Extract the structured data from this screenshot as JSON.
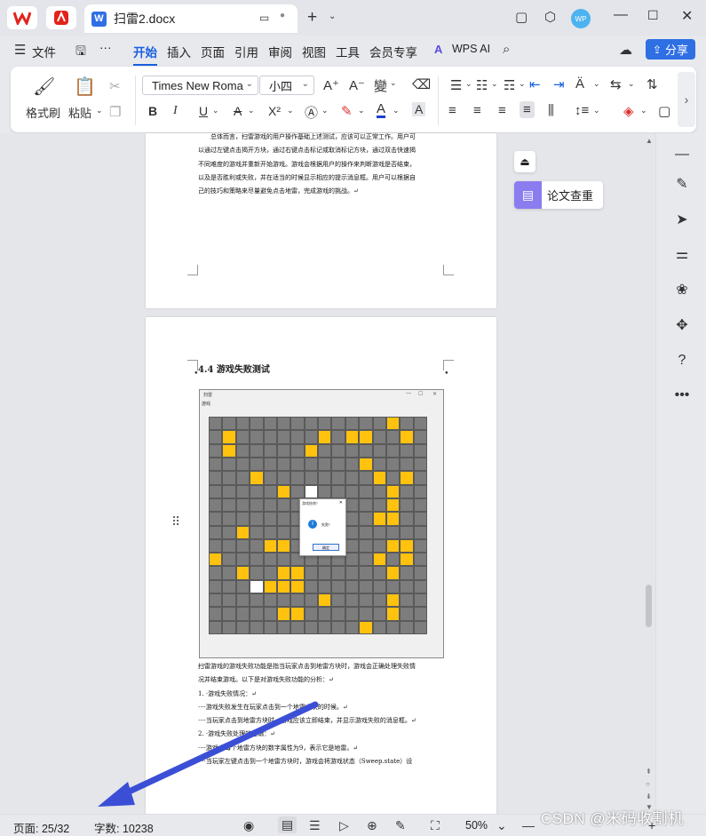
{
  "titlebar": {
    "tab_title": "扫雷2.docx",
    "avatar_text": "WP"
  },
  "menubar": {
    "file": "文件",
    "more": "···",
    "tabs": [
      "开始",
      "插入",
      "页面",
      "引用",
      "审阅",
      "视图",
      "工具",
      "会员专享"
    ],
    "active_tab": "开始",
    "wps_ai": "WPS AI",
    "share": "分享"
  },
  "ribbon": {
    "format_painter": "格式刷",
    "paste": "粘贴",
    "font_name": "Times New Roma",
    "font_size": "小四"
  },
  "document": {
    "page1_text": [
      "总体而言，扫雷游戏的用户操作基础上述测试，应该可以正常工作。用户可",
      "以通过左键点击揭开方块，通过右键点击标记或取消标记方块，通过双击快速揭",
      "不同难度的游戏并重新开始游戏。游戏会根据用户的操作来判断游戏是否结束，",
      "以及是否胜利或失败，并在适当的时候显示相应的提示消息框。用户可以根据自",
      "己的技巧和策略来尽量避免点击地雷，完成游戏的挑战。↵"
    ],
    "section_heading": "4.4 游戏失败测试",
    "game_window_title": "扫雷",
    "game_menu": "游戏",
    "dialog_title": "游戏结束！",
    "dialog_message": "失败！",
    "dialog_button": "确定",
    "page2_text": [
      "扫雷游戏的游戏失败功能是指当玩家点击到地雷方块时，游戏会正确处理失败情",
      "况并结束游戏。以下是对游戏失败功能的分析：↵",
      "1. ·游戏失败情况：↵",
      "····游戏失败发生在玩家点击到一个地雷方块的时候。↵",
      "····当玩家点击到地雷方块时，游戏应该立即结束，并显示游戏失败的消息框。↵",
      "2. ·游戏失败处理的逻辑：↵",
      "····游戏中每个地雷方块的数字属性为9，表示它是地雷。↵",
      "····当玩家左键点击到一个地雷方块时，游戏会将游戏状态（Sweep.state）设"
    ]
  },
  "side_panel": {
    "paper_check": "论文查重"
  },
  "statusbar": {
    "page": "页面: 25/32",
    "word_count": "字数: 10238",
    "zoom": "50%"
  },
  "watermark": "CSDN @米码收割机",
  "colors": {
    "accent": "#1a5fe0",
    "share_button": "#2f6fe4",
    "mine_cell": "#ffc20e",
    "hidden_cell": "#7d7d7d",
    "arrow": "#3b4fd6"
  }
}
